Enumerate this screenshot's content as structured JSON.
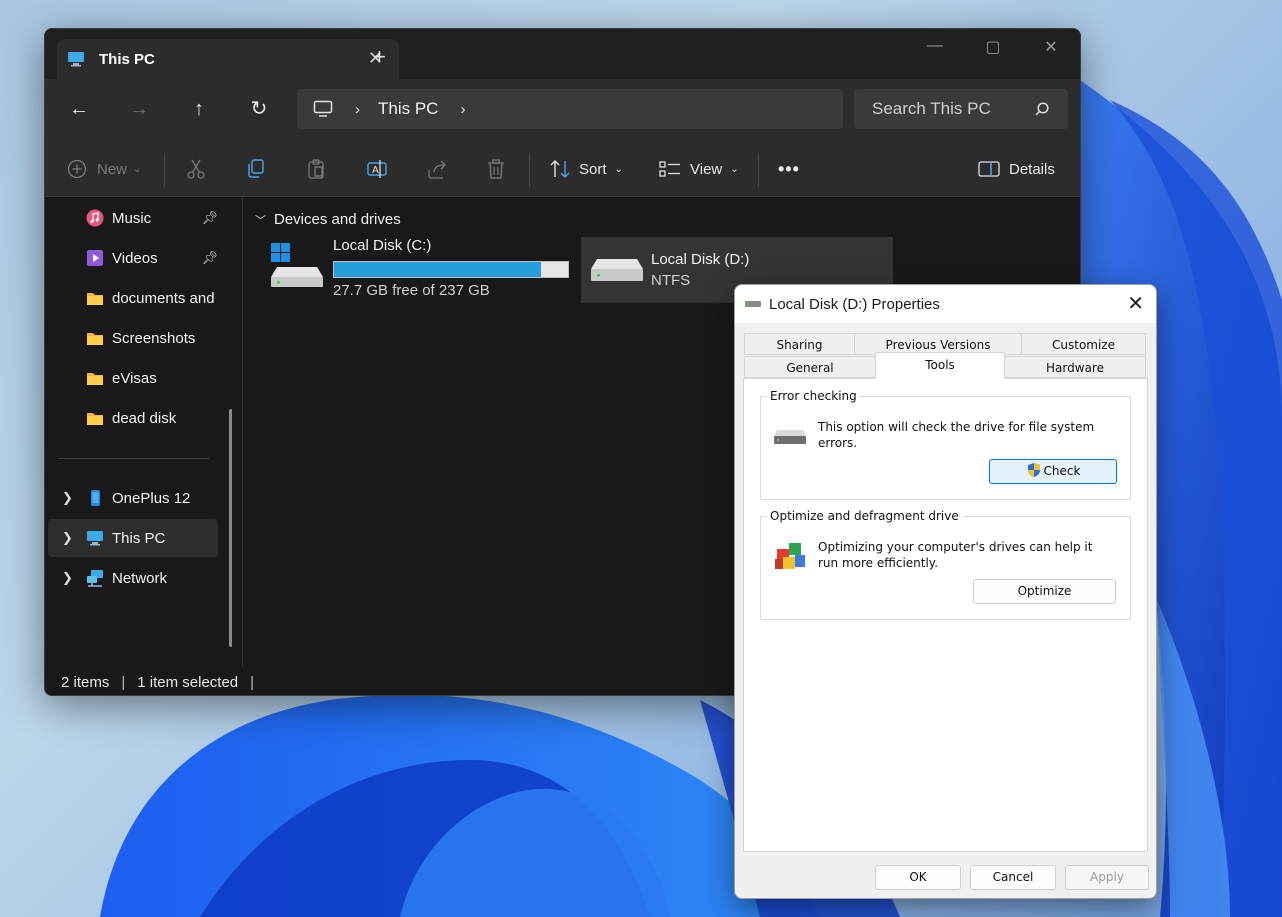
{
  "explorer": {
    "tab_title": "This PC",
    "tab_close": "✕",
    "new_tab": "+",
    "window_controls": {
      "minimize": "—",
      "maximize": "▢",
      "close": "✕"
    },
    "nav": {
      "back": "←",
      "forward": "→",
      "up": "↑",
      "refresh": "↻"
    },
    "address": {
      "segment": "This PC",
      "chevron": "›"
    },
    "search_placeholder": "Search This PC",
    "commands": {
      "new": "New",
      "sort": "Sort",
      "view": "View",
      "more": "•••",
      "details": "Details"
    },
    "sidebar": [
      {
        "label": "Music",
        "pinned": true,
        "icon": "music-icon"
      },
      {
        "label": "Videos",
        "pinned": true,
        "icon": "videos-icon"
      },
      {
        "label": "documents and",
        "icon": "folder-icon"
      },
      {
        "label": "Screenshots",
        "icon": "folder-icon"
      },
      {
        "label": "eVisas",
        "icon": "folder-icon"
      },
      {
        "label": "dead disk",
        "icon": "folder-icon"
      },
      {
        "label": "OnePlus 12",
        "icon": "phone-icon",
        "expandable": true
      },
      {
        "label": "This PC",
        "icon": "computer-icon",
        "expandable": true,
        "selected": true
      },
      {
        "label": "Network",
        "icon": "network-icon",
        "expandable": true
      }
    ],
    "section_header": "Devices and drives",
    "drives": [
      {
        "name": "Local Disk (C:)",
        "free_text": "27.7 GB free of 237 GB",
        "used_fraction": 0.883
      },
      {
        "name": "Local Disk (D:)",
        "filesystem": "NTFS",
        "selected": true
      }
    ],
    "status": {
      "items": "2 items",
      "selected": "1 item selected",
      "sep": "|"
    }
  },
  "dialog": {
    "title": "Local Disk (D:) Properties",
    "close": "✕",
    "tabs_top": [
      "Sharing",
      "Previous Versions",
      "Customize"
    ],
    "tabs_bottom": [
      "General",
      "Tools",
      "Hardware"
    ],
    "active_tab": "Tools",
    "error_checking": {
      "title": "Error checking",
      "text": "This option will check the drive for file system errors.",
      "button": "Check"
    },
    "optimize": {
      "title": "Optimize and defragment drive",
      "text": "Optimizing your computer's drives can help it run more efficiently.",
      "button": "Optimize"
    },
    "buttons": {
      "ok": "OK",
      "cancel": "Cancel",
      "apply": "Apply"
    }
  },
  "colors": {
    "accent": "#26a0da",
    "explorer_bg": "#191919",
    "toolbar_bg": "#2c2c2c",
    "dialog_bg": "#f0f0f0",
    "primary_button_border": "#0078d7"
  }
}
